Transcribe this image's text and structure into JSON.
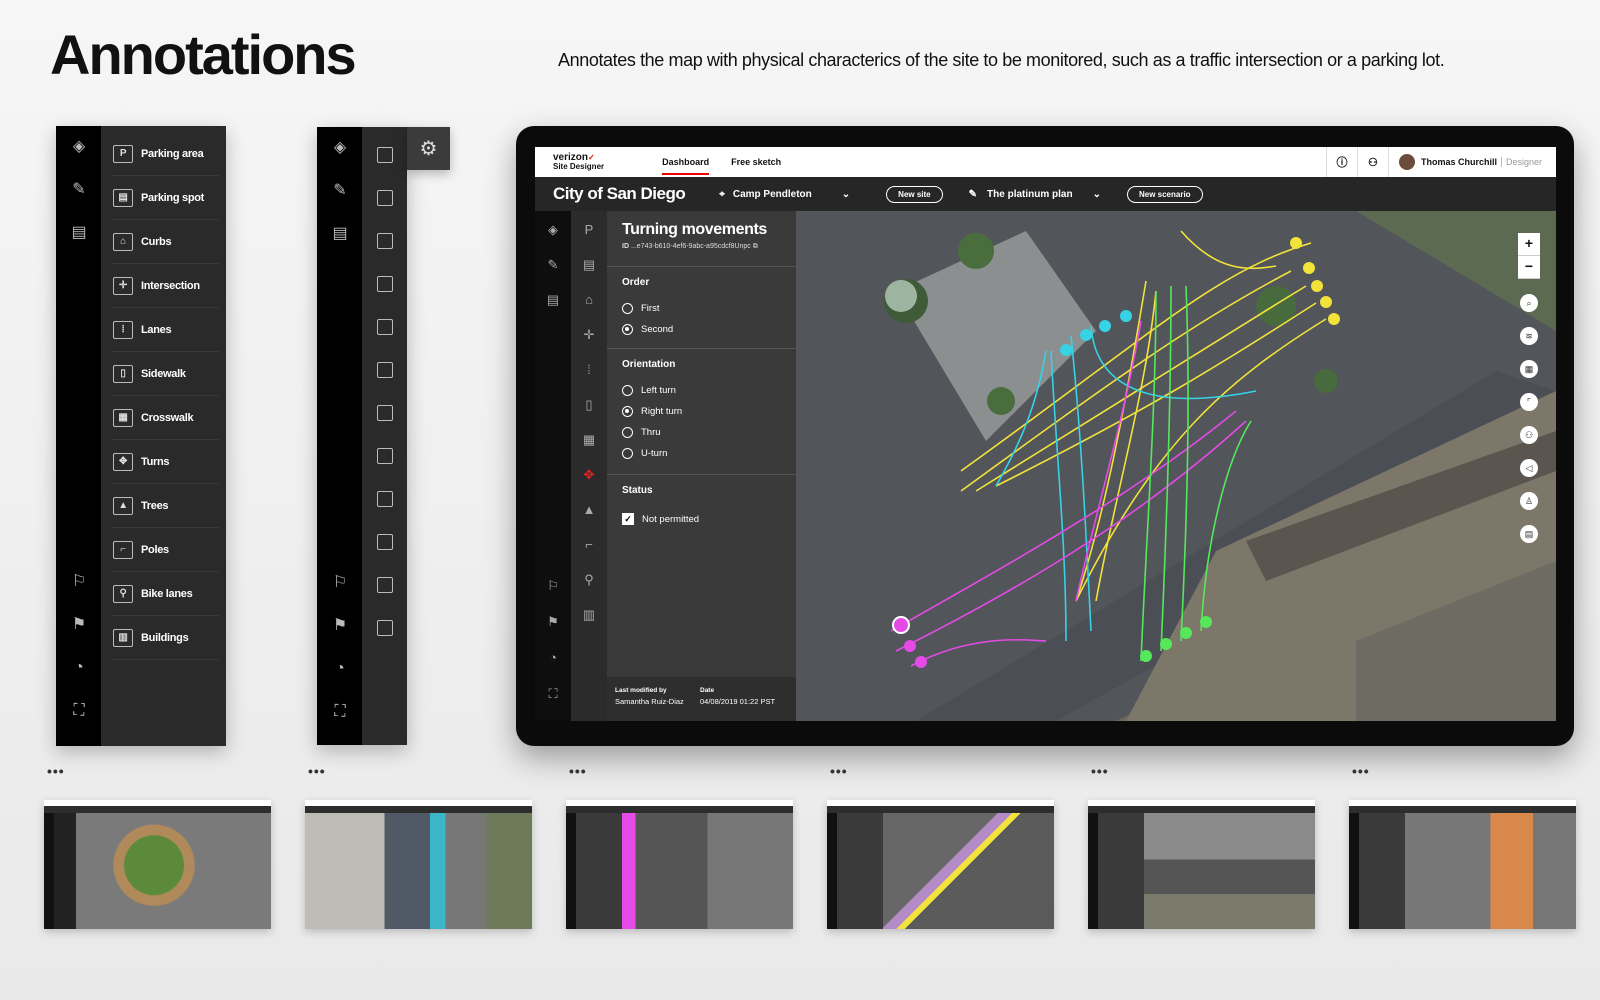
{
  "header": {
    "title": "Annotations",
    "description": "Annotates the map with physical characterics of the site to be monitored, such as a traffic intersection or a parking lot."
  },
  "annotation_menu": {
    "items": [
      {
        "label": "Parking area",
        "icon": "parking-area-icon",
        "glyph": "P"
      },
      {
        "label": "Parking spot",
        "icon": "parking-spot-icon",
        "glyph": "▤"
      },
      {
        "label": "Curbs",
        "icon": "curbs-icon",
        "glyph": "⌂"
      },
      {
        "label": "Intersection",
        "icon": "intersection-icon",
        "glyph": "✛"
      },
      {
        "label": "Lanes",
        "icon": "lanes-icon",
        "glyph": "⦙"
      },
      {
        "label": "Sidewalk",
        "icon": "sidewalk-icon",
        "glyph": "▯"
      },
      {
        "label": "Crosswalk",
        "icon": "crosswalk-icon",
        "glyph": "▦"
      },
      {
        "label": "Turns",
        "icon": "turns-icon",
        "glyph": "✥"
      },
      {
        "label": "Trees",
        "icon": "trees-icon",
        "glyph": "▲"
      },
      {
        "label": "Poles",
        "icon": "poles-icon",
        "glyph": "⌐"
      },
      {
        "label": "Bike lanes",
        "icon": "bike-icon",
        "glyph": "⚲"
      },
      {
        "label": "Buildings",
        "icon": "buildings-icon",
        "glyph": "▥"
      }
    ]
  },
  "app": {
    "brand": "verizon",
    "brand_sub": "Site Designer",
    "nav": [
      "Dashboard",
      "Free sketch"
    ],
    "user_name": "Thomas Churchill",
    "user_role": "Designer",
    "city": "City of San Diego",
    "location": "Camp Pendleton",
    "new_site": "New site",
    "plan": "The platinum plan",
    "new_scenario": "New scenario",
    "panel": {
      "title": "Turning movements",
      "id_label": "ID",
      "id_value": "...e743-b610-4ef6-9abc-a95cdcf8Unpc",
      "order_label": "Order",
      "order_options": [
        "First",
        "Second"
      ],
      "order_selected": "Second",
      "orientation_label": "Orientation",
      "orientation_options": [
        "Left turn",
        "Right turn",
        "Thru",
        "U-turn"
      ],
      "orientation_selected": "Right turn",
      "status_label": "Status",
      "status_option": "Not permitted",
      "modified_label": "Last modified by",
      "modified_by": "Samantha Ruiz-Diaz",
      "date_label": "Date",
      "date_value": "04/08/2019  01:22 PST"
    },
    "map_zoom_in": "+",
    "map_zoom_out": "−"
  },
  "colors": {
    "accent_red": "#e00000",
    "path_yellow": "#f2e23a",
    "path_cyan": "#36d2e6",
    "path_magenta": "#e64ae6",
    "path_green": "#55e85a"
  }
}
